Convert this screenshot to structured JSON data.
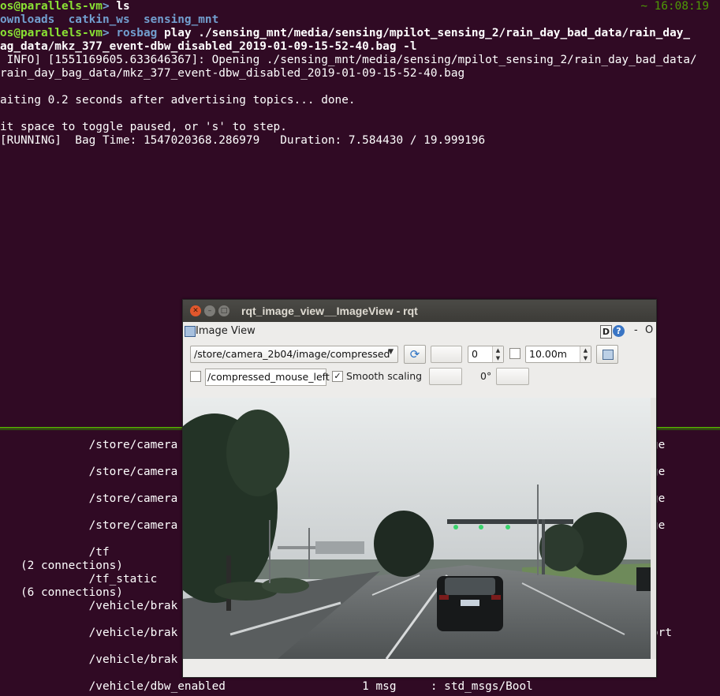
{
  "terminal_top": {
    "clock": "~ 16:08:19",
    "line1": {
      "user": "os@parallels-vm",
      "sep": ">",
      "cmd": "ls"
    },
    "ls_items": [
      "ownloads",
      "catkin_ws",
      "sensing_mnt"
    ],
    "line3": {
      "user": "os@parallels-vm",
      "sep": ">",
      "cmd_name": "rosbag",
      "cmd_args": "play ./sensing_mnt/media/sensing/mpilot_sensing_2/rain_day_bad_data/rain_day_"
    },
    "line4": "ag_data/mkz_377_event-dbw_disabled_2019-01-09-15-52-40.bag -l",
    "line5": " INFO] [1551169605.633646367]: Opening ./sensing_mnt/media/sensing/mpilot_sensing_2/rain_day_bad_data/",
    "line6": "rain_day_bag_data/mkz_377_event-dbw_disabled_2019-01-09-15-52-40.bag",
    "line7": "aiting 0.2 seconds after advertising topics... done.",
    "line8": "it space to toggle paused, or 's' to step.",
    "line9": "[RUNNING]  Bag Time: 1547020368.286979   Duration: 7.584430 / 19.999196"
  },
  "terminal_bottom": {
    "lines": [
      {
        "text": "             /store/camera",
        "right": "ge"
      },
      {
        "text": "             /store/camera",
        "right": "ge"
      },
      {
        "text": "             /store/camera",
        "right": "ge"
      },
      {
        "text": "             /store/camera",
        "right": "ge"
      },
      {
        "text": "             /tf",
        "right": ""
      },
      {
        "text": "   (2 connections)",
        "right": ""
      },
      {
        "text": "             /tf_static",
        "right": ""
      },
      {
        "text": "   (6 connections)",
        "right": ""
      },
      {
        "text": "             /vehicle/brak",
        "right": ""
      },
      {
        "text": "             /vehicle/brak",
        "right": "ort"
      },
      {
        "text": "             /vehicle/brak",
        "right": ""
      },
      {
        "text": "             /vehicle/dbw_enabled                    1 msg     : std_msgs/Bool",
        "right": ""
      }
    ]
  },
  "window": {
    "title": "rqt_image_view__ImageView - rqt",
    "plugin_title": "Image View",
    "help_d": "D",
    "help_q": "?",
    "dash": "-",
    "close_o": "O",
    "close_glyph": "✕",
    "min_glyph": "–",
    "max_glyph": "□",
    "topic_value": "/store/camera_2b04/image/compressed",
    "combo_arrow": "▼",
    "refresh_glyph": "⟳",
    "spin_value": "0",
    "zoom_value": "10.00m",
    "spin_up": "▲",
    "spin_down": "▼",
    "mouse_topic": "/compressed_mouse_left",
    "smooth_checked": "✓",
    "smooth_label": "Smooth scaling",
    "rotation_label": "0°"
  }
}
